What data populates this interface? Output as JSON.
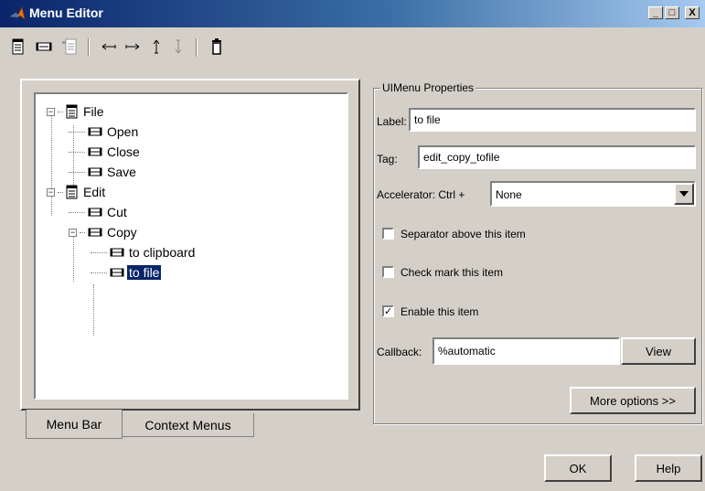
{
  "window": {
    "title": "Menu Editor",
    "minimize": "_",
    "maximize": "□",
    "close": "X"
  },
  "toolbar": {
    "items": [
      "new-menu-icon",
      "new-menu-item-icon",
      "new-context-menu-icon",
      "move-left-icon",
      "move-right-icon",
      "move-up-icon",
      "move-down-icon",
      "delete-icon"
    ]
  },
  "tree": {
    "nodes": [
      {
        "label": "File",
        "type": "menu",
        "level": 0
      },
      {
        "label": "Open",
        "type": "item",
        "level": 1
      },
      {
        "label": "Close",
        "type": "item",
        "level": 1
      },
      {
        "label": "Save",
        "type": "item",
        "level": 1
      },
      {
        "label": "Edit",
        "type": "menu",
        "level": 0
      },
      {
        "label": "Cut",
        "type": "item",
        "level": 1
      },
      {
        "label": "Copy",
        "type": "item",
        "level": 1
      },
      {
        "label": "to clipboard",
        "type": "item",
        "level": 2
      },
      {
        "label": "to file",
        "type": "item",
        "level": 2,
        "selected": true
      }
    ]
  },
  "tabs": {
    "menu_bar": "Menu Bar",
    "context_menus": "Context Menus"
  },
  "props": {
    "group_title": "UIMenu Properties",
    "label_caption": "Label:",
    "label_value": "to file",
    "tag_caption": "Tag:",
    "tag_value": "edit_copy_tofile",
    "accel_caption": "Accelerator: Ctrl +",
    "accel_value": "None",
    "separator_label": "Separator above this item",
    "separator_checked": false,
    "checkmark_label": "Check mark this item",
    "checkmark_checked": false,
    "enable_label": "Enable this item",
    "enable_checked": true,
    "callback_caption": "Callback:",
    "callback_value": "%automatic",
    "view_button": "View",
    "more_options_button": "More options >>"
  },
  "footer": {
    "ok_button": "OK",
    "help_button": "Help"
  },
  "colors": {
    "title_start": "#0a246a",
    "selection": "#0a246a",
    "face": "#d4d0c8"
  }
}
